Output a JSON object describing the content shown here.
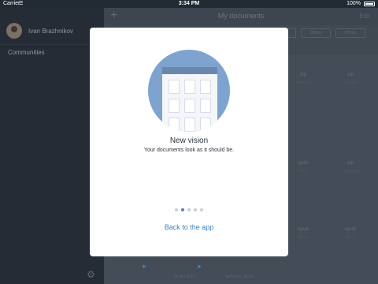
{
  "status_bar": {
    "carrier": "Carrier",
    "time": "3:34 PM",
    "battery": "100%"
  },
  "sidebar": {
    "profile_name": "Ivan Brazhnikov",
    "items": [
      {
        "label": "Communities"
      }
    ]
  },
  "main": {
    "title": "My documents",
    "edit_label": "Edit",
    "filters": [
      "Ft",
      "Other",
      "Other"
    ],
    "documents": [
      {
        "ext": "zip",
        "sub": "Archives"
      },
      {
        "ext": "zip",
        "sub": "Archives"
      },
      {
        "ext": "zip",
        "sub": "Archives"
      },
      {
        "ext": "pptx",
        "sub": "Text"
      },
      {
        "ext": "zip",
        "sub": "Archives"
      },
      {
        "ext": "epub",
        "sub": "Other"
      },
      {
        "ext": "epub",
        "sub": "Other"
      }
    ],
    "bottom_items": [
      "04 Jun 2016",
      "tjsPrinter_65.txt"
    ]
  },
  "modal": {
    "title": "New vision",
    "subtitle": "Your documents look as it should be.",
    "page_count": 5,
    "active_page": 2,
    "back_label": "Back to the app"
  },
  "colors": {
    "accent": "#3c7fc4",
    "illustration_bg": "#7ea3cf",
    "sidebar_bg": "#252c36"
  }
}
